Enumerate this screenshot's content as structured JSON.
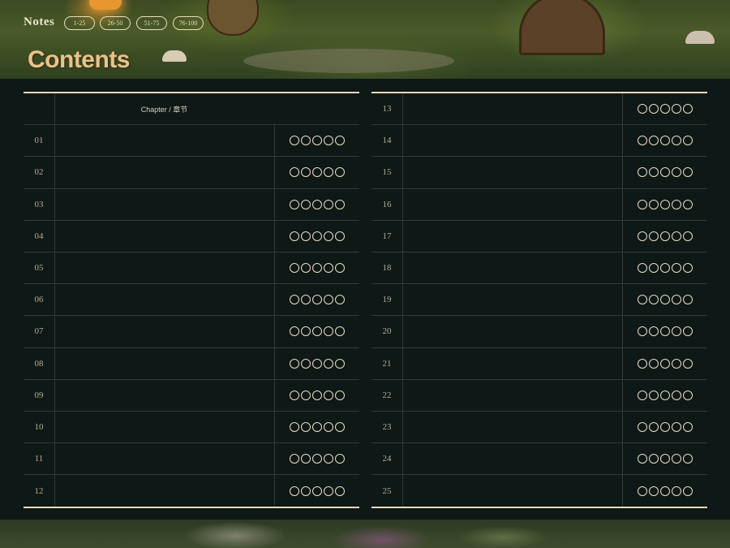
{
  "header": {
    "notes_label": "Notes",
    "ranges": [
      "1-25",
      "26-50",
      "51-75",
      "76-100"
    ],
    "title": "Contents"
  },
  "table": {
    "column_header": "Chapter / 章节",
    "left_rows": [
      "01",
      "02",
      "03",
      "04",
      "05",
      "06",
      "07",
      "08",
      "09",
      "10",
      "11",
      "12"
    ],
    "right_rows": [
      "13",
      "14",
      "15",
      "16",
      "17",
      "18",
      "19",
      "20",
      "21",
      "22",
      "23",
      "24",
      "25"
    ],
    "rating_slots": 5
  },
  "colors": {
    "background": "#0e1816",
    "rule": "#e6dbbd",
    "title": "#e6c48a"
  }
}
